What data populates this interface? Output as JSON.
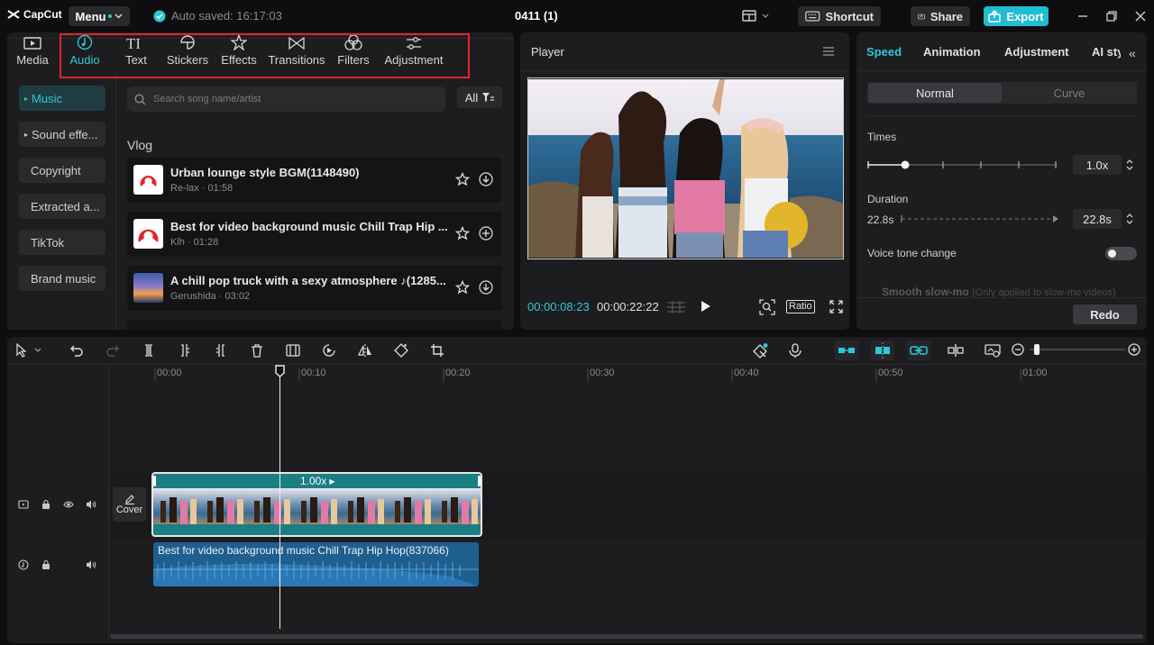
{
  "app": {
    "logo_text": "CapCut",
    "menu_label": "Menu",
    "autosave": "Auto saved: 16:17:03",
    "project_title": "0411 (1)",
    "shortcut_label": "Shortcut",
    "share_label": "Share",
    "export_label": "Export",
    "accent": "#2ec8d6",
    "highlight": "#e3242b"
  },
  "tabs": [
    {
      "label": "Media",
      "icon": "media-icon"
    },
    {
      "label": "Audio",
      "icon": "audio-icon",
      "active": true
    },
    {
      "label": "Text",
      "icon": "text-icon"
    },
    {
      "label": "Stickers",
      "icon": "sticker-icon"
    },
    {
      "label": "Effects",
      "icon": "effects-icon"
    },
    {
      "label": "Transitions",
      "icon": "transition-icon"
    },
    {
      "label": "Filters",
      "icon": "filters-icon"
    },
    {
      "label": "Adjustment",
      "icon": "adjustment-icon"
    }
  ],
  "sidebar": {
    "items": [
      "Music",
      "Sound effe...",
      "Copyright",
      "Extracted a...",
      "TikTok",
      "Brand music"
    ]
  },
  "search": {
    "placeholder": "Search song name/artist",
    "filter_label": "All"
  },
  "section": "Vlog",
  "songs": [
    {
      "title": "Urban lounge style BGM(1148490)",
      "meta": "Re-lax · 01:58"
    },
    {
      "title": "Best for video background music Chill Trap Hip ...",
      "meta": "Klh · 01:28"
    },
    {
      "title": "A chill pop truck with a sexy atmosphere ♪(1285...",
      "meta": "Gerushida · 03:02"
    }
  ],
  "player": {
    "title": "Player",
    "current_time": "00:00:08:23",
    "total_time": "00:00:22:22",
    "ratio_label": "Ratio"
  },
  "props": {
    "tabs": [
      "Speed",
      "Animation",
      "Adjustment",
      "AI sty"
    ],
    "modes": [
      "Normal",
      "Curve"
    ],
    "times_label": "Times",
    "times_value": "1.0x",
    "duration_label": "Duration",
    "duration_from": "22.8s",
    "duration_value": "22.8s",
    "voice_label": "Voice tone change",
    "smooth_label": "Smooth slow-mo",
    "smooth_note": "(Only applied to slow-mo videos)",
    "redo_label": "Redo"
  },
  "timeline": {
    "ticks": [
      "00:00",
      "00:10",
      "00:20",
      "00:30",
      "00:40",
      "00:50",
      "01:00"
    ],
    "clip_speed": "1.00x",
    "audio_title": "Best for video background music Chill Trap Hip Hop(837066)",
    "cover_label": "Cover"
  }
}
